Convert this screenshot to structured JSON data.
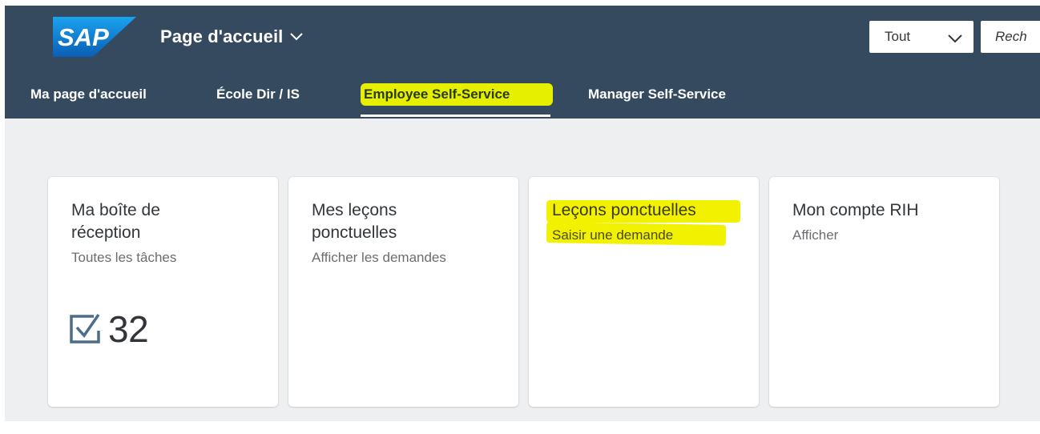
{
  "shell": {
    "logo_text": "SAP",
    "title": "Page d'accueil",
    "scope_select": {
      "value": "Tout"
    },
    "search": {
      "placeholder": "Rech"
    },
    "colors": {
      "header": "#354a5f",
      "brand_blue": "#0a6ed1",
      "highlight": "#e6ef00"
    }
  },
  "tabs": [
    {
      "label": "Ma page d'accueil",
      "active": false
    },
    {
      "label": "École Dir / IS",
      "active": false
    },
    {
      "label": "Employee Self-Service",
      "active": true
    },
    {
      "label": "Manager Self-Service",
      "active": false
    }
  ],
  "tiles": [
    {
      "title_line1": "Ma boîte de",
      "title_line2": "réception",
      "subtitle": "Toutes les tâches",
      "icon": "task-check-icon",
      "kpi": "32"
    },
    {
      "title_line1": "Mes leçons",
      "title_line2": "ponctuelles",
      "subtitle": "Afficher les demandes"
    },
    {
      "title_line1": "Leçons ponctuelles",
      "subtitle": "Saisir une demande",
      "highlighted": true
    },
    {
      "title_line1": "Mon compte RIH",
      "subtitle": "Afficher"
    }
  ]
}
